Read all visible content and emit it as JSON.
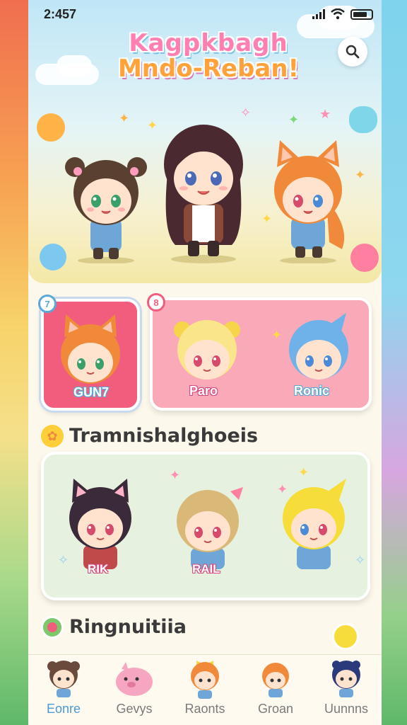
{
  "status_bar": {
    "time": "2:457"
  },
  "header": {
    "title_line1": "Kagpkbagh",
    "title_line2": "Mndo-Reban!"
  },
  "featured_cards": [
    {
      "badge": "7",
      "name": "GUN7"
    },
    {
      "badge": "8",
      "names": [
        "Paro",
        "Ronic"
      ]
    }
  ],
  "section_trending": {
    "title": "Tramnishalghoeis",
    "items": [
      {
        "name": "RIK"
      },
      {
        "name": "RAIL"
      },
      {
        "name": ""
      }
    ]
  },
  "section_recent": {
    "title": "Ringnuitiia"
  },
  "bottom_nav": [
    {
      "label": "Eonre",
      "active": true
    },
    {
      "label": "Gevys",
      "active": false
    },
    {
      "label": "Raonts",
      "active": false
    },
    {
      "label": "Groan",
      "active": false
    },
    {
      "label": "Uunnns",
      "active": false
    }
  ],
  "colors": {
    "accent": "#4a9ad6",
    "card_primary": "#f25d7e",
    "card_secondary": "#f9a9b8",
    "panel": "#e6f2df"
  }
}
